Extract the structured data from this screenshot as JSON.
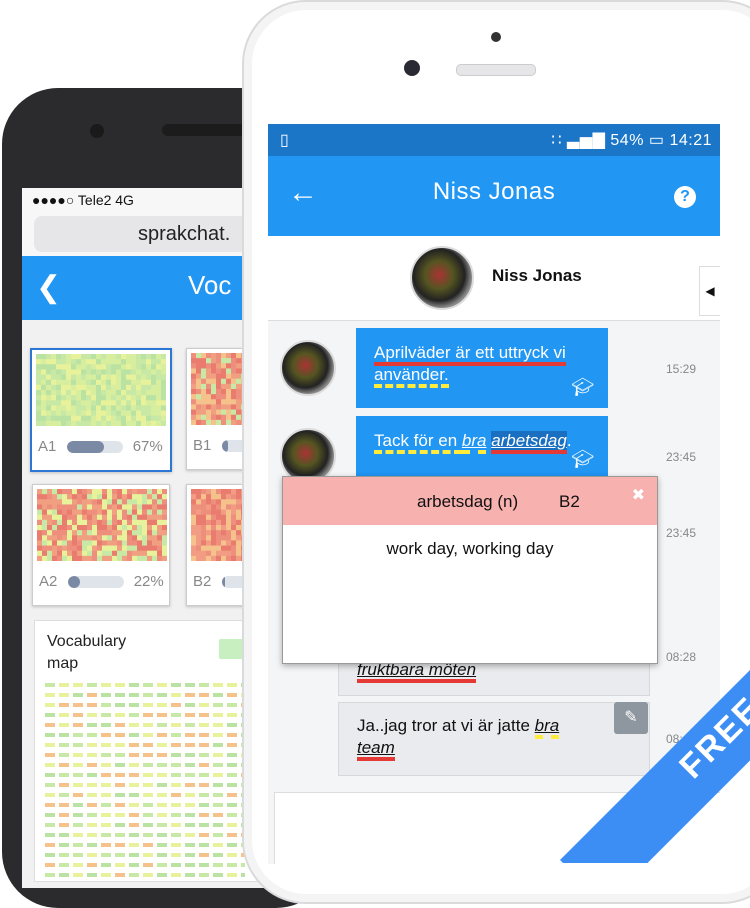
{
  "back_phone": {
    "carrier": "●●●●○ Tele2  4G",
    "url": "sprakchat.",
    "back_icon": "chevron-left-icon",
    "title": "Voc",
    "cards": [
      {
        "level": "A1",
        "percent": "67%",
        "progress": 0.67
      },
      {
        "level": "B1",
        "percent": "",
        "progress": 0.12
      },
      {
        "level": "A2",
        "percent": "22%",
        "progress": 0.22
      },
      {
        "level": "B2",
        "percent": "",
        "progress": 0.06
      }
    ],
    "vocab_map_title": "Vocabulary map"
  },
  "front_phone": {
    "status": {
      "battery": "54%",
      "time": "14:21"
    },
    "appbar": {
      "back_icon": "arrow-left-icon",
      "title": "Niss Jonas",
      "help_icon": "help-icon",
      "help": "?"
    },
    "header": {
      "name": "Niss Jonas"
    },
    "messages": [
      {
        "line1": "Aprilväder är ett uttryck vi",
        "line2": "använder.",
        "time": "15:29"
      },
      {
        "pre": "Tack för en ",
        "w1": "bra",
        "w2": "arbetsdag",
        "post": ".",
        "time": "23:45"
      }
    ],
    "extra_time": "23:45",
    "popup": {
      "word": "arbetsdag (n)",
      "level": "B2",
      "close": "✖",
      "definition": "work day, working day"
    },
    "gray_messages": [
      {
        "text": "fruktbara möten",
        "time": "08:28"
      },
      {
        "line1_pre": "Ja..jag tror at vi är jatte ",
        "line1_em": "bra",
        "line2_em": "team",
        "time": "08:"
      }
    ]
  },
  "ribbon": {
    "label": "FREE"
  },
  "colors": {
    "primary": "#2196f3",
    "status": "#1c76c8",
    "popup_header": "#f7b1ae",
    "underline_red": "#e53935",
    "underline_yellow": "#ffeb3b",
    "ribbon": "#3c8ef5"
  }
}
